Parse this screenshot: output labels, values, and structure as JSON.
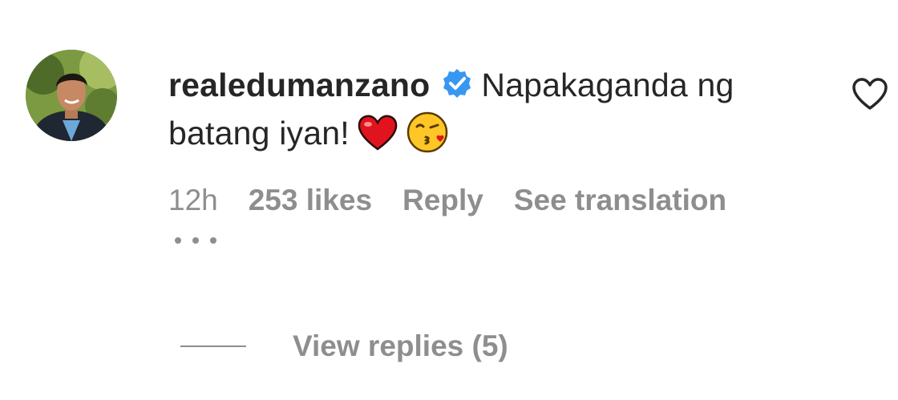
{
  "comment": {
    "username": "realedumanzano",
    "text_line": "Napakaganda ng batang iyan!",
    "emojis": [
      "red-heart-emoji",
      "face-blowing-kiss-emoji"
    ],
    "timestamp": "12h",
    "likes": "253 likes",
    "reply_label": "Reply",
    "translation_label": "See translation",
    "more_icon": "more-horizontal-icon",
    "like_icon": "heart-outline-icon",
    "verified_icon": "verified-badge-icon"
  },
  "replies": {
    "label": "View replies (5)"
  },
  "colors": {
    "text": "#262626",
    "secondary": "#8e8e8e",
    "verified": "#3897f0",
    "heart": "#ed1c24"
  }
}
